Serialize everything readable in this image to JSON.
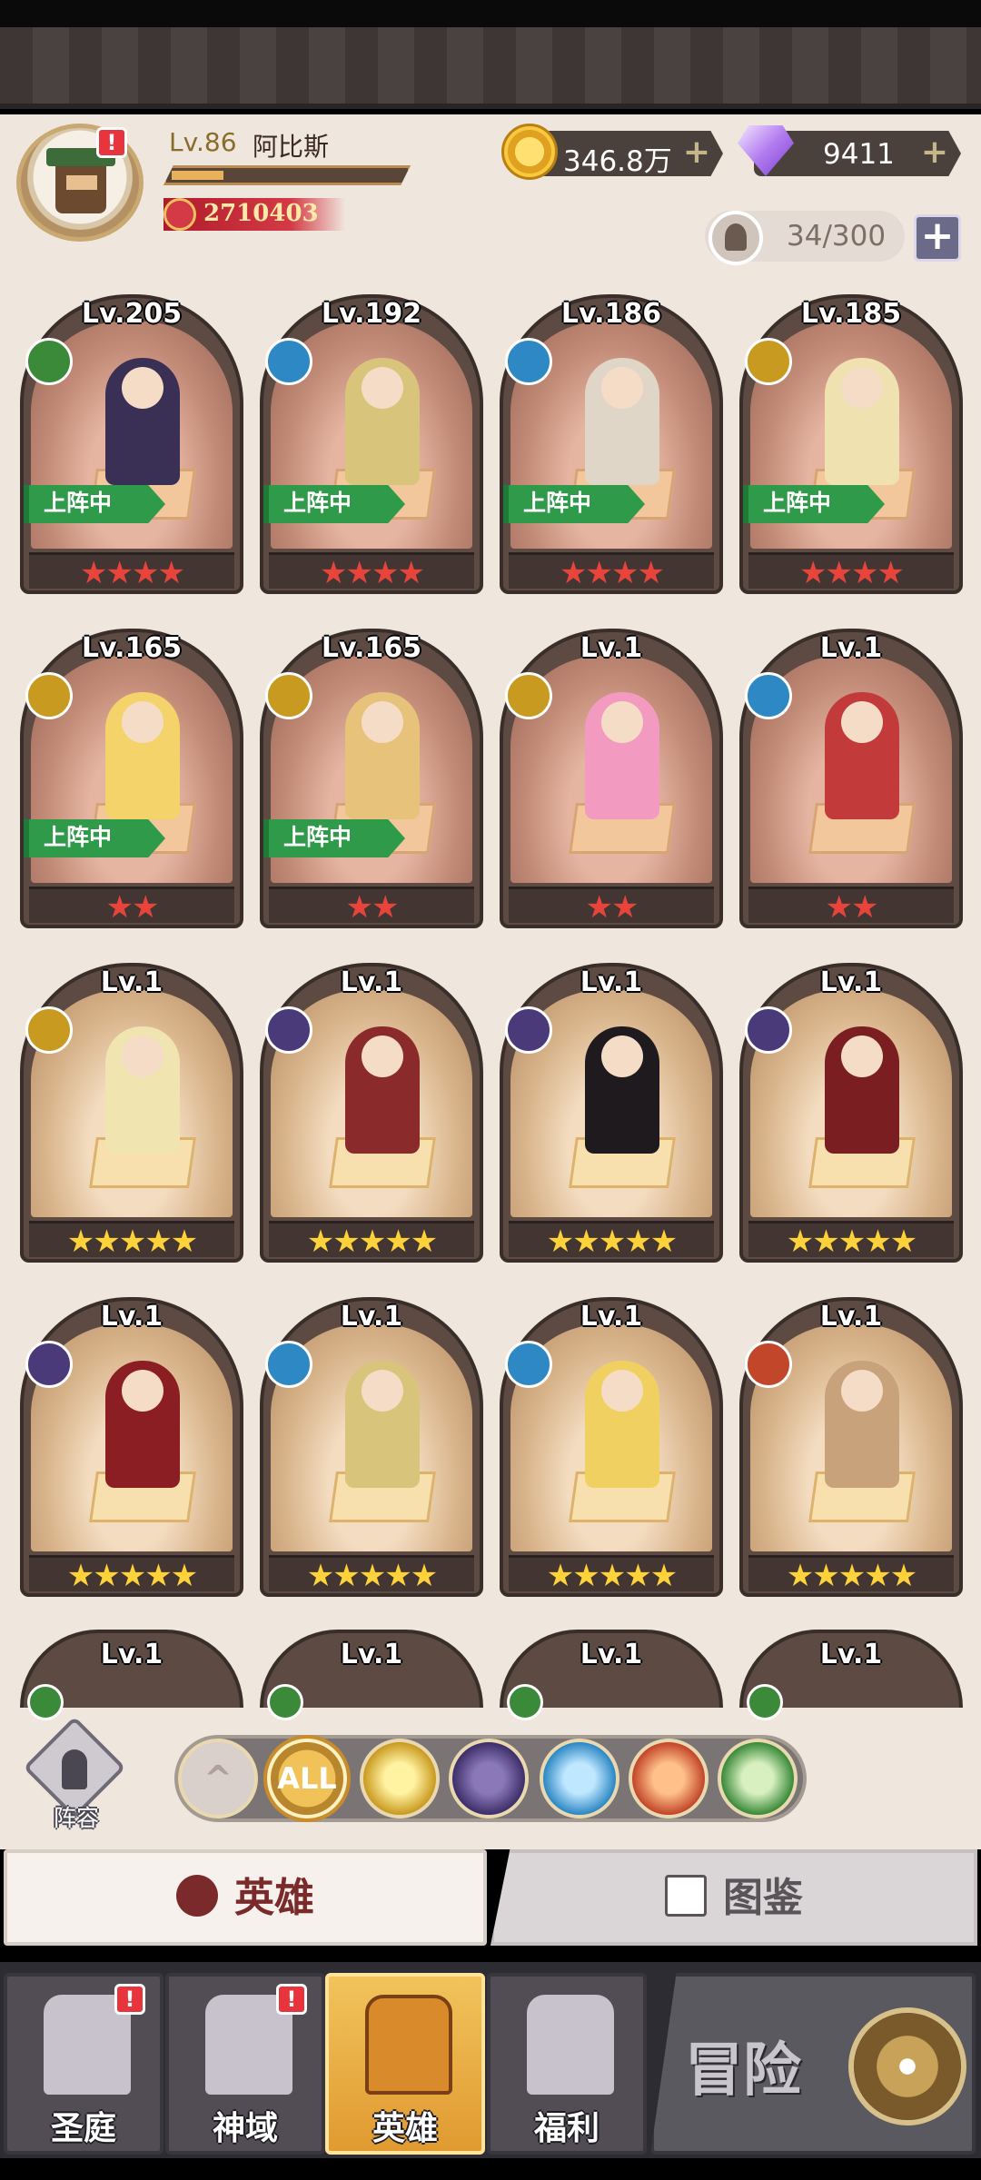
{
  "player": {
    "level": "Lv.86",
    "name": "阿比斯",
    "power": "2710403",
    "xp_progress": 0.22
  },
  "currency": {
    "gold": "346.8万",
    "gems": "9411"
  },
  "capacity": "34/300",
  "alerts": {
    "avatar": "!",
    "nav_courtyard": "!",
    "nav_divine": "!"
  },
  "colors": {
    "red_star": "#e8443c",
    "gold_star": "#ffd23a",
    "badge_green": "#2e9a4a",
    "active_tab": "#7a2a2a"
  },
  "deployed_label": "上阵中",
  "heroes": [
    {
      "level": "Lv.205",
      "faction": "wood",
      "stars": "★★★★",
      "rarity": "red",
      "deployed": true
    },
    {
      "level": "Lv.192",
      "faction": "water",
      "stars": "★★★★",
      "rarity": "red",
      "deployed": true
    },
    {
      "level": "Lv.186",
      "faction": "water",
      "stars": "★★★★",
      "rarity": "red",
      "deployed": true
    },
    {
      "level": "Lv.185",
      "faction": "light",
      "stars": "★★★★",
      "rarity": "red",
      "deployed": true
    },
    {
      "level": "Lv.165",
      "faction": "light",
      "stars": "★★",
      "rarity": "red",
      "deployed": true
    },
    {
      "level": "Lv.165",
      "faction": "light",
      "stars": "★★",
      "rarity": "red",
      "deployed": true
    },
    {
      "level": "Lv.1",
      "faction": "light",
      "stars": "★★",
      "rarity": "red",
      "deployed": false
    },
    {
      "level": "Lv.1",
      "faction": "water",
      "stars": "★★",
      "rarity": "red",
      "deployed": false
    },
    {
      "level": "Lv.1",
      "faction": "light",
      "stars": "★★★★★",
      "rarity": "gold",
      "deployed": false
    },
    {
      "level": "Lv.1",
      "faction": "dark",
      "stars": "★★★★★",
      "rarity": "gold",
      "deployed": false
    },
    {
      "level": "Lv.1",
      "faction": "dark",
      "stars": "★★★★★",
      "rarity": "gold",
      "deployed": false
    },
    {
      "level": "Lv.1",
      "faction": "dark",
      "stars": "★★★★★",
      "rarity": "gold",
      "deployed": false
    },
    {
      "level": "Lv.1",
      "faction": "dark",
      "stars": "★★★★★",
      "rarity": "gold",
      "deployed": false
    },
    {
      "level": "Lv.1",
      "faction": "water",
      "stars": "★★★★★",
      "rarity": "gold",
      "deployed": false
    },
    {
      "level": "Lv.1",
      "faction": "water",
      "stars": "★★★★★",
      "rarity": "gold",
      "deployed": false
    },
    {
      "level": "Lv.1",
      "faction": "fire",
      "stars": "★★★★★",
      "rarity": "gold",
      "deployed": false
    }
  ],
  "partial_row": [
    "Lv.1",
    "Lv.1",
    "Lv.1",
    "Lv.1"
  ],
  "formation_label": "阵容",
  "filters": {
    "up": "^",
    "all": "ALL",
    "icons": [
      "light-icon",
      "dark-icon",
      "water-icon",
      "fire-icon",
      "wood-icon"
    ]
  },
  "tabs": {
    "heroes": "英雄",
    "codex": "图鉴"
  },
  "nav": {
    "courtyard": "圣庭",
    "divine": "神域",
    "heroes": "英雄",
    "welfare": "福利",
    "adventure": "冒险"
  }
}
